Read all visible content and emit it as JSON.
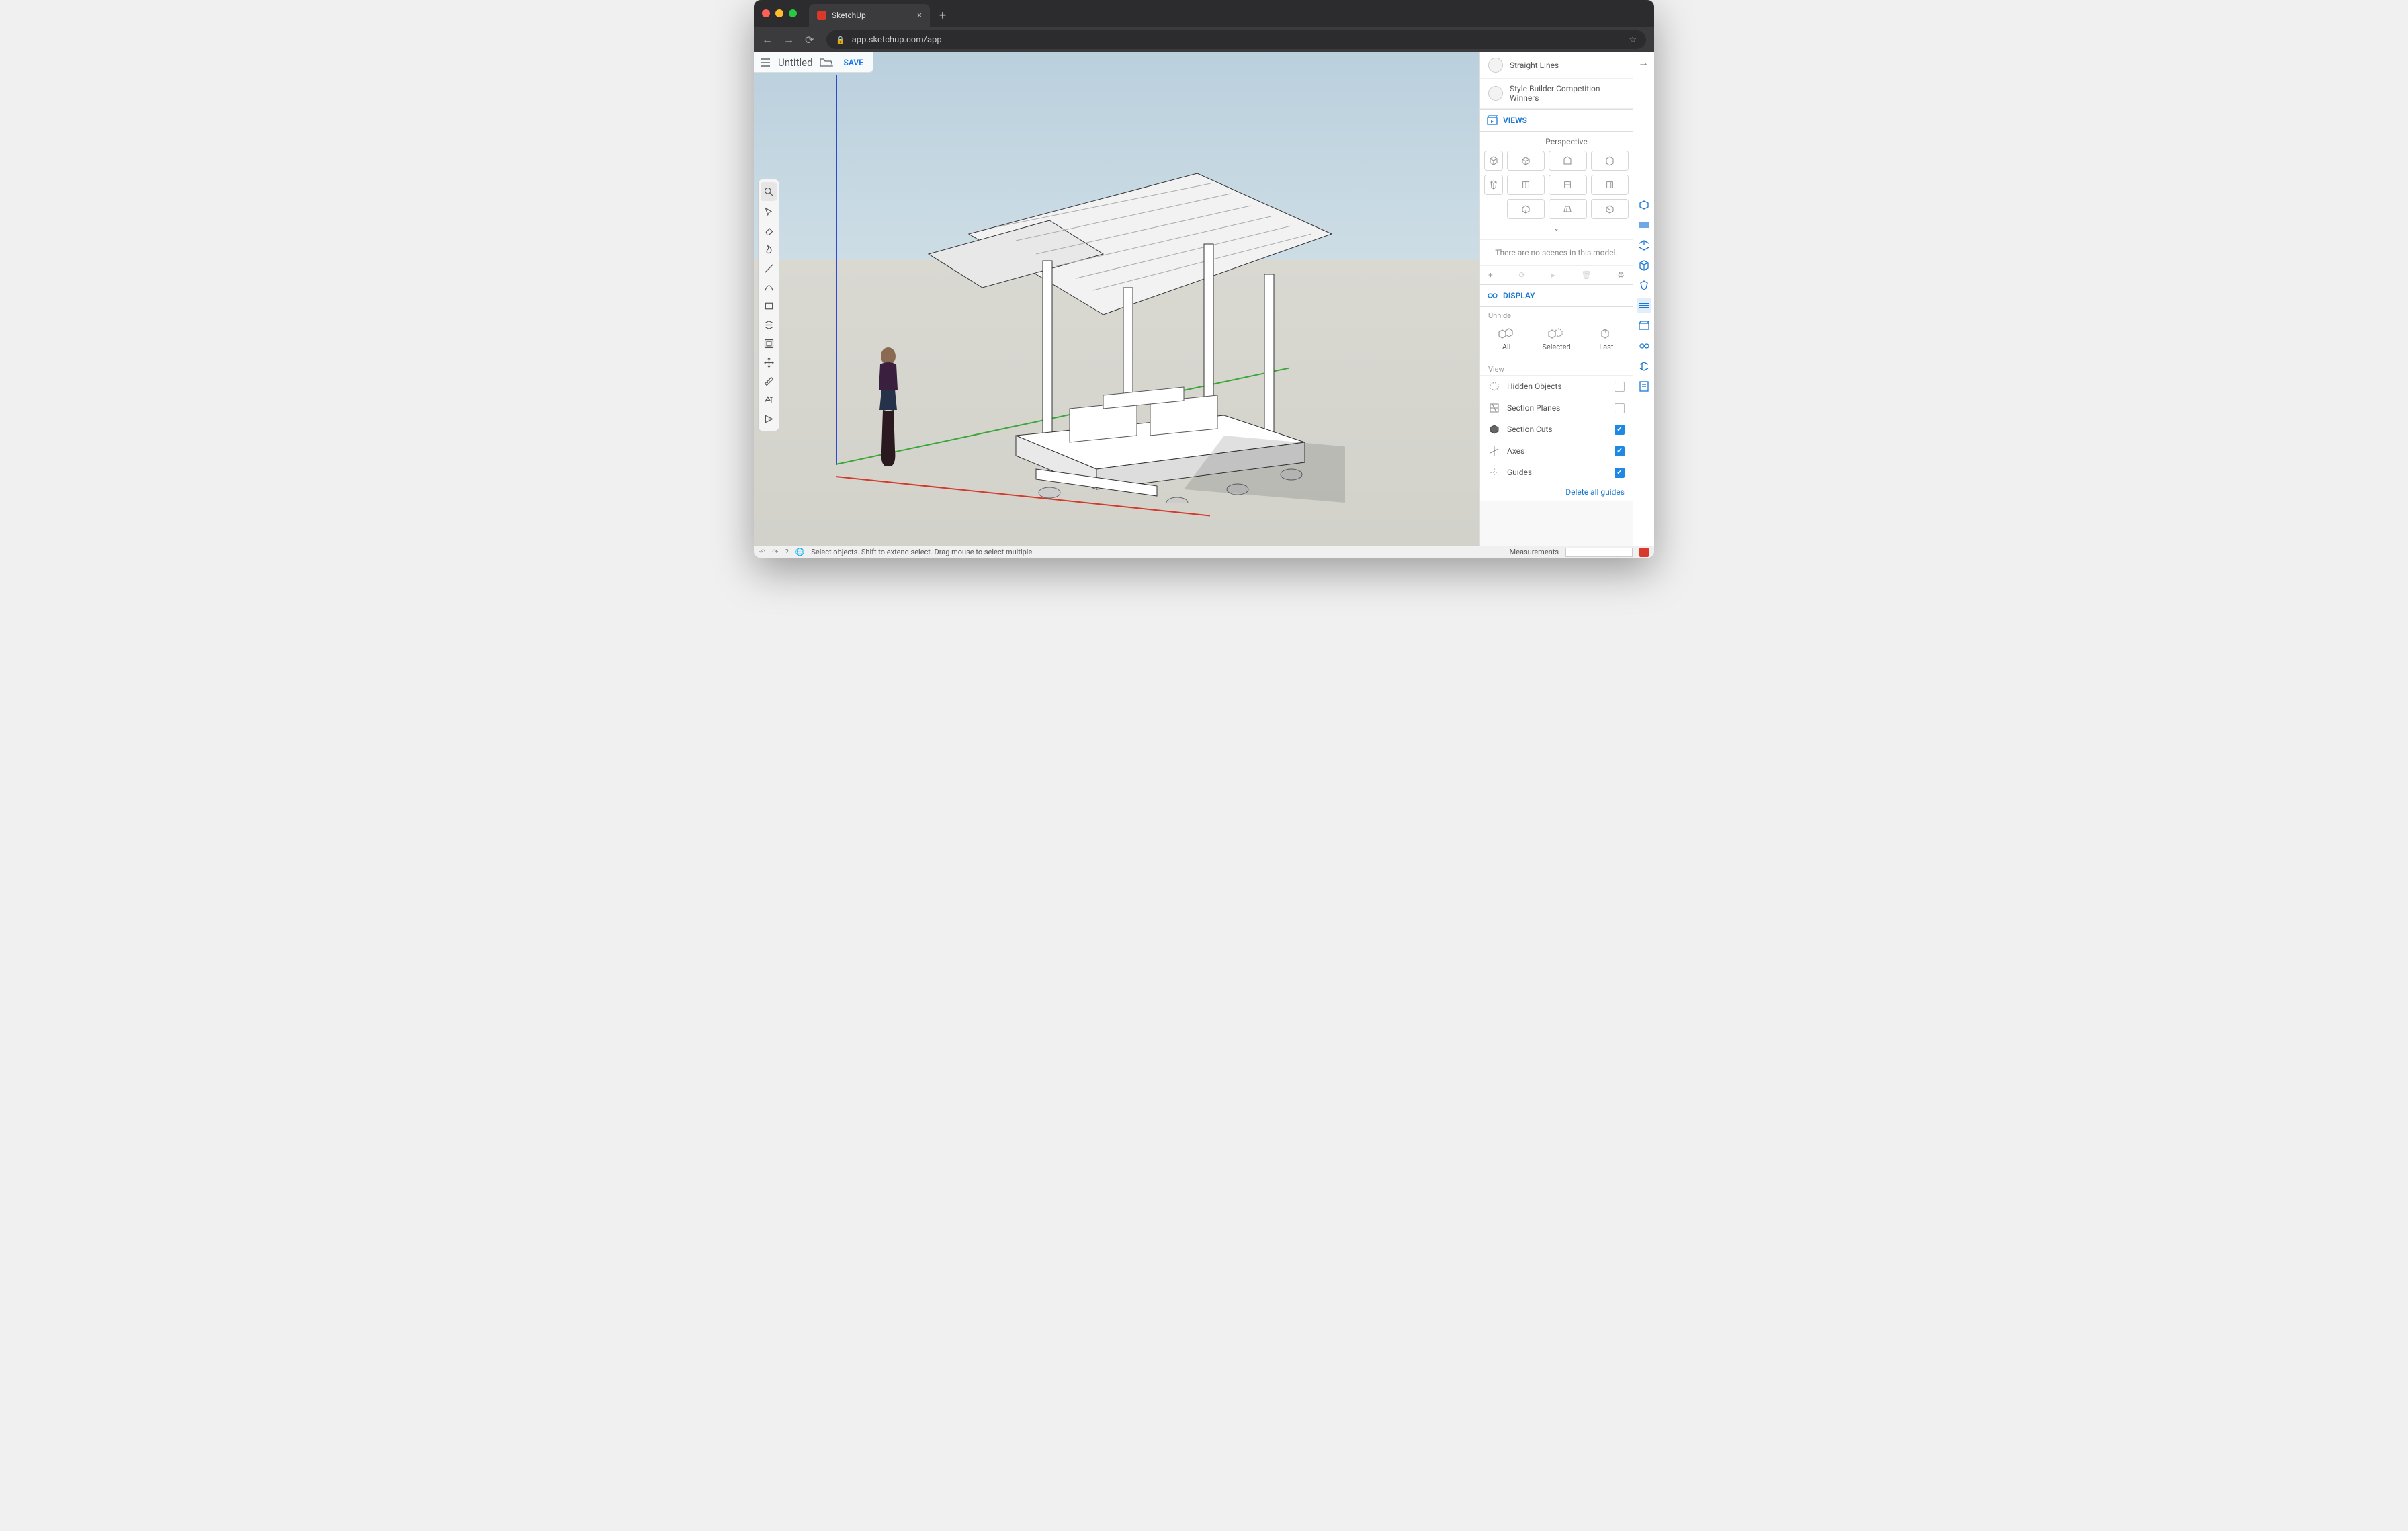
{
  "browser": {
    "tab_title": "SketchUp",
    "url": "app.sketchup.com/app"
  },
  "header": {
    "title": "Untitled",
    "save": "SAVE"
  },
  "styles_list": {
    "item1": "Straight Lines",
    "item2": "Style Builder Competition Winners"
  },
  "panels": {
    "views_title": "VIEWS",
    "perspective_label": "Perspective",
    "scenes_empty": "There are no scenes in this model.",
    "display_title": "DISPLAY",
    "unhide_label": "Unhide",
    "unhide": {
      "all": "All",
      "selected": "Selected",
      "last": "Last"
    },
    "view_label": "View",
    "opts": {
      "hidden_objects": "Hidden Objects",
      "section_planes": "Section Planes",
      "section_cuts": "Section Cuts",
      "axes": "Axes",
      "guides": "Guides"
    },
    "delete_guides": "Delete all guides"
  },
  "status": {
    "hint": "Select objects. Shift to extend select. Drag mouse to select multiple.",
    "measurements": "Measurements"
  }
}
